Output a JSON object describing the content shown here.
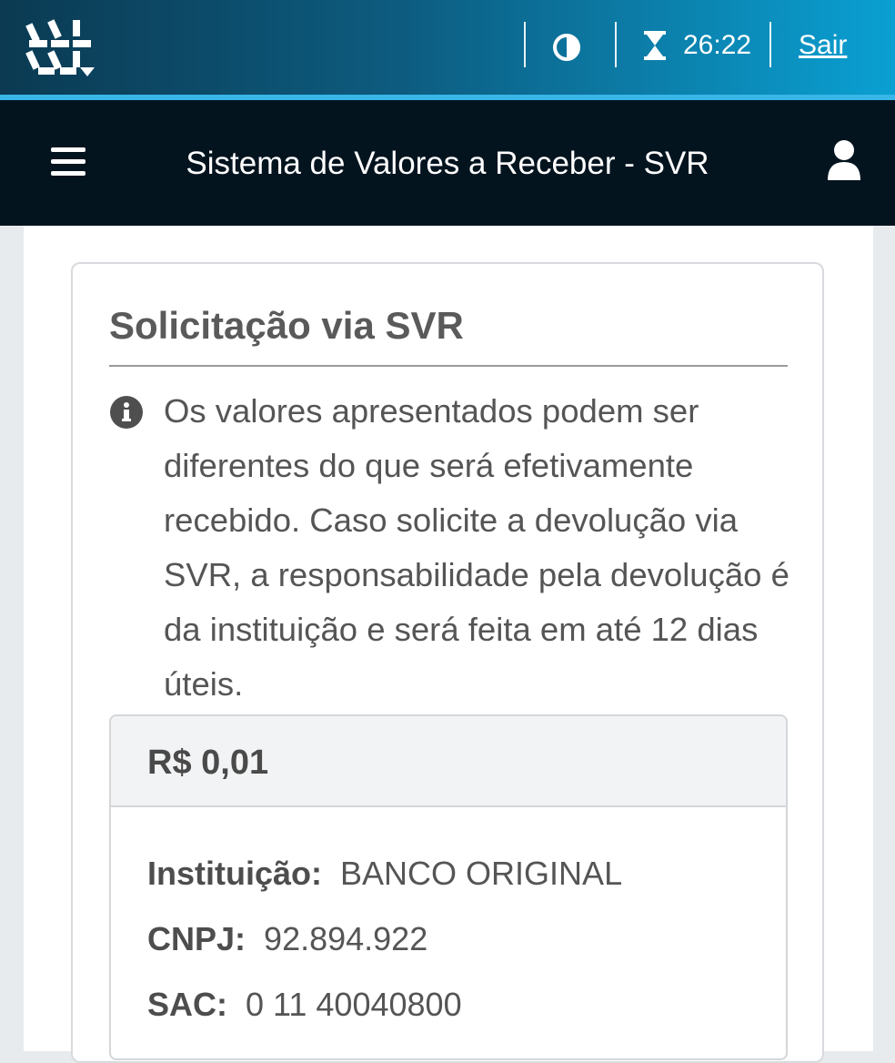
{
  "topbar": {
    "timer": "26:22",
    "logout_label": "Sair",
    "icons": [
      "gov-logo-icon",
      "contrast-icon",
      "hourglass-icon"
    ]
  },
  "header": {
    "title": "Sistema de Valores a Receber - SVR",
    "icons": [
      "menu-icon",
      "user-icon"
    ]
  },
  "card": {
    "title": "Solicitação via SVR",
    "info_text": "Os valores apresentados podem ser diferentes do que será efetivamente recebido. Caso solicite a devolução via SVR, a responsabilidade pela devolução é da instituição e será feita em até 12 dias úteis.",
    "value": {
      "amount": "R$ 0,01",
      "institution_label": "Instituição:",
      "institution": "BANCO ORIGINAL",
      "cnpj_label": "CNPJ:",
      "cnpj": "92.894.922",
      "sac_label": "SAC:",
      "sac": "0 11 40040800"
    }
  },
  "colors": {
    "topbar_start": "#0b3a52",
    "topbar_end": "#0aa0d2",
    "header_bg": "#03141f",
    "text_muted": "#555555"
  }
}
